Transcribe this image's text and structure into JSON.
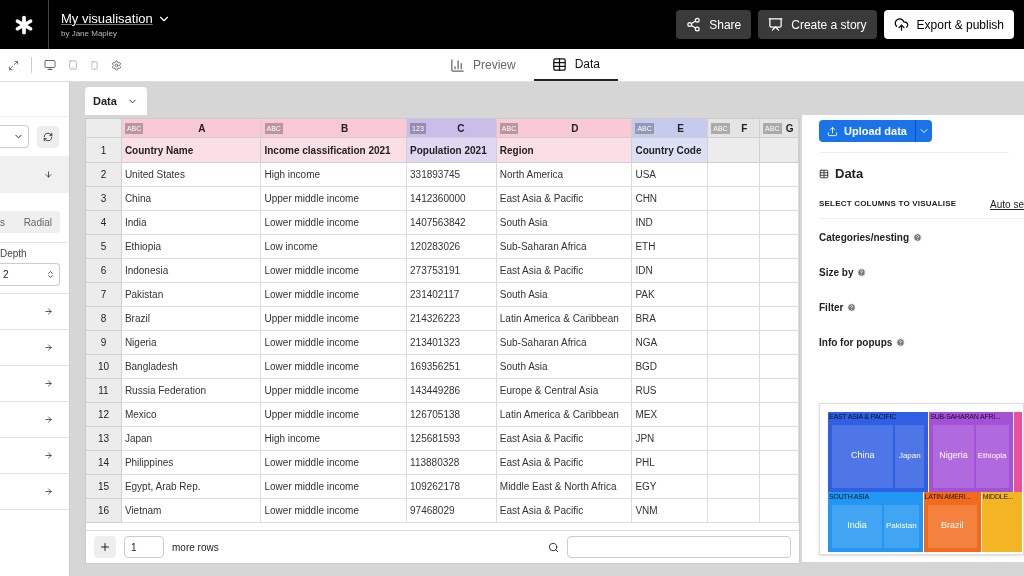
{
  "header": {
    "title": "My visualisation",
    "author": "by Jane Mapley",
    "buttons": [
      {
        "label": "Share",
        "kind": "share"
      },
      {
        "label": "Create a story",
        "kind": "story"
      },
      {
        "label": "Export & publish",
        "kind": "export"
      }
    ]
  },
  "view_tabs": [
    {
      "label": "Preview",
      "kind": "preview",
      "selected": false
    },
    {
      "label": "Data",
      "kind": "data",
      "selected": true
    }
  ],
  "left_panel": {
    "segment": [
      "s",
      "Radial"
    ],
    "depth_label": "Depth",
    "depth_value": "2"
  },
  "sheet_tab": {
    "label": "Data"
  },
  "sheet": {
    "columns": [
      {
        "letter": "A",
        "type": "ABC",
        "color": "#f9c9d5"
      },
      {
        "letter": "B",
        "type": "ABC",
        "color": "#f9c9d5"
      },
      {
        "letter": "C",
        "type": "123",
        "color": "#cbbdea"
      },
      {
        "letter": "D",
        "type": "ABC",
        "color": "#f9c9d5"
      },
      {
        "letter": "E",
        "type": "ABC",
        "color": "#c5cbef"
      },
      {
        "letter": "F",
        "type": "ABC",
        "color": "#e4e4e4"
      },
      {
        "letter": "G",
        "type": "ABC",
        "color": "#e4e4e4"
      }
    ],
    "header_row": {
      "number": "1",
      "cells": [
        "Country Name",
        "Income classification 2021",
        "Population 2021",
        "Region",
        "Country Code"
      ]
    },
    "rows": [
      {
        "number": "2",
        "cells": [
          "United States",
          "High income",
          "331893745",
          "North America",
          "USA"
        ]
      },
      {
        "number": "3",
        "cells": [
          "China",
          "Upper middle income",
          "1412360000",
          "East Asia & Pacific",
          "CHN"
        ]
      },
      {
        "number": "4",
        "cells": [
          "India",
          "Lower middle income",
          "1407563842",
          "South Asia",
          "IND"
        ]
      },
      {
        "number": "5",
        "cells": [
          "Ethiopia",
          "Low income",
          "120283026",
          "Sub-Saharan Africa",
          "ETH"
        ]
      },
      {
        "number": "6",
        "cells": [
          "Indonesia",
          "Lower middle income",
          "273753191",
          "East Asia & Pacific",
          "IDN"
        ]
      },
      {
        "number": "7",
        "cells": [
          "Pakistan",
          "Lower middle income",
          "231402117",
          "South Asia",
          "PAK"
        ]
      },
      {
        "number": "8",
        "cells": [
          "Brazil",
          "Upper middle income",
          "214326223",
          "Latin America & Caribbean",
          "BRA"
        ]
      },
      {
        "number": "9",
        "cells": [
          "Nigeria",
          "Lower middle income",
          "213401323",
          "Sub-Saharan Africa",
          "NGA"
        ]
      },
      {
        "number": "10",
        "cells": [
          "Bangladesh",
          "Lower middle income",
          "169356251",
          "South Asia",
          "BGD"
        ]
      },
      {
        "number": "11",
        "cells": [
          "Russia Federation",
          "Upper middle income",
          "143449286",
          "Europe & Central Asia",
          "RUS"
        ]
      },
      {
        "number": "12",
        "cells": [
          "Mexico",
          "Upper middle income",
          "126705138",
          "Latin America & Caribbean",
          "MEX"
        ]
      },
      {
        "number": "13",
        "cells": [
          "Japan",
          "High income",
          "125681593",
          "East Asia & Pacific",
          "JPN"
        ]
      },
      {
        "number": "14",
        "cells": [
          "Philippines",
          "Lower middle income",
          "113880328",
          "East Asia & Pacific",
          "PHL"
        ]
      },
      {
        "number": "15",
        "cells": [
          "Egypt, Arab Rep.",
          "Lower middle income",
          "109262178",
          "Middle East & North Africa",
          "EGY"
        ]
      },
      {
        "number": "16",
        "cells": [
          "Vietnam",
          "Lower middle income",
          "97468029",
          "East Asia & Pacific",
          "VNM"
        ]
      }
    ],
    "footer": {
      "add_count": "1",
      "more_label": "more rows"
    }
  },
  "right_panel": {
    "upload_label": "Upload data",
    "section_title": "Data",
    "select_label": "SELECT COLUMNS TO VISUALISE",
    "auto_link": "Auto se",
    "fields": [
      "Categories/nesting",
      "Size by",
      "Filter",
      "Info for popups"
    ],
    "preview_top": [
      {
        "label": "EAST ASIA & PACIFIC",
        "color": "#2f5fe3",
        "items": [
          "China",
          "Japan"
        ]
      },
      {
        "label": "SUB-SAHARAN AFRI...",
        "color": "#a351d9",
        "items": [
          "Nigeria",
          "Ethiopia"
        ]
      },
      {
        "color": "#ec4f9b"
      }
    ],
    "preview_bottom": [
      {
        "label": "SOUTH ASIA",
        "color": "#2196f3",
        "items": [
          "India",
          "Pakistan"
        ]
      },
      {
        "label": "LATIN AMERI...",
        "color": "#f26b1d",
        "items": [
          "Brazil"
        ]
      },
      {
        "label": "MIDDLE...",
        "color": "#f4b524"
      }
    ]
  }
}
